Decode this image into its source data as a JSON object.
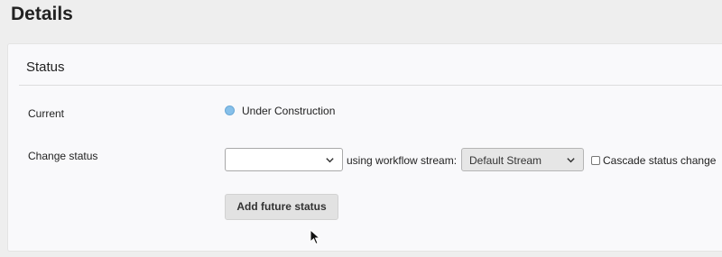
{
  "page": {
    "title": "Details"
  },
  "status_panel": {
    "title": "Status",
    "current": {
      "label": "Current",
      "value": "Under Construction",
      "dot_color": "#86c0ea"
    },
    "change": {
      "label": "Change status",
      "status_select_value": "",
      "stream_text": "using workflow stream:",
      "stream_select_value": "Default Stream",
      "cascade_label": "Cascade status change",
      "cascade_checked": false
    },
    "add_button_label": "Add future status"
  },
  "icons": {
    "dropdown": "chevron-down-icon",
    "cursor": "mouse-pointer-icon"
  }
}
